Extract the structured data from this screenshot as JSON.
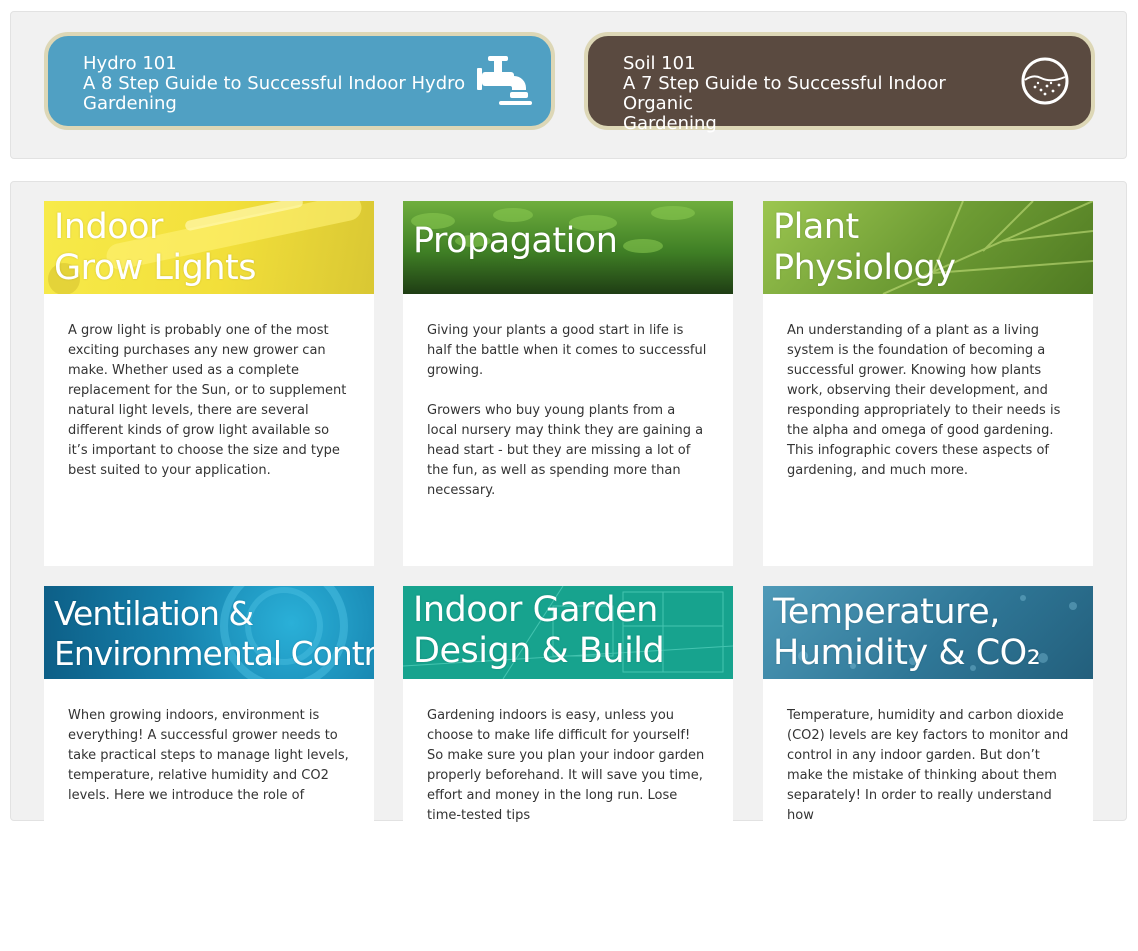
{
  "guides": [
    {
      "title": "Hydro 101",
      "subtitle_line1": "A 8 Step Guide to Successful Indoor Hydro",
      "subtitle_line2": "Gardening",
      "icon": "faucet-icon",
      "color": "#50a0c3"
    },
    {
      "title": "Soil 101",
      "subtitle_line1": "A 7 Step Guide to Successful Indoor Organic",
      "subtitle_line2": "Gardening",
      "icon": "soil-circle-icon",
      "color": "#5a4a40"
    }
  ],
  "cards": [
    {
      "title_line1": "Indoor",
      "title_line2": "Grow Lights",
      "header_color": "#f2e13d",
      "paragraphs": [
        "A grow light is probably one of the most exciting purchases any new grower can make. Whether used as a complete replacement for the Sun, or to supplement natural light levels, there are several different kinds of grow light available so it’s important to choose the size and type best suited to your application."
      ]
    },
    {
      "title_line1": "Propagation",
      "title_line2": "",
      "header_color": "#4a8a2c",
      "paragraphs": [
        "Giving your plants a good start in life is half the battle when it comes to successful growing.",
        "Growers who buy young plants from a local nursery may think they are gaining a head start - but they are missing a lot of the fun, as well as spending more than necessary."
      ]
    },
    {
      "title_line1": "Plant",
      "title_line2": "Physiology",
      "header_color": "#7aa83a",
      "paragraphs": [
        "An understanding of a plant as a living system is the foundation of becoming a successful grower. Knowing how plants work, observing their development, and responding appropriately to their needs is the alpha and omega of good gardening. This infographic covers these aspects of gardening, and much more."
      ]
    },
    {
      "title_line1": "Ventilation &",
      "title_line2": "Environmental Control",
      "header_color": "#1a8fb8",
      "paragraphs": [
        "When growing indoors, environment is everything! A successful grower needs to take practical steps to manage light levels, temperature, relative humidity and CO2 levels. Here we introduce the role of"
      ]
    },
    {
      "title_line1": "Indoor Garden",
      "title_line2": "Design & Build",
      "header_color": "#1fa08e",
      "paragraphs": [
        "Gardening indoors is easy, unless you choose to make life difficult for yourself! So make sure you plan your indoor garden properly beforehand. It will save you time, effort and money in the long run. Lose time-tested tips"
      ]
    },
    {
      "title_line1": "Temperature,",
      "title_line2": "Humidity & CO₂",
      "header_color": "#3a86a4",
      "paragraphs": [
        "Temperature, humidity and carbon dioxide (CO2) levels are key factors to monitor and control in any indoor garden. But don’t make the mistake of thinking about them separately! In order to really understand how"
      ]
    }
  ]
}
